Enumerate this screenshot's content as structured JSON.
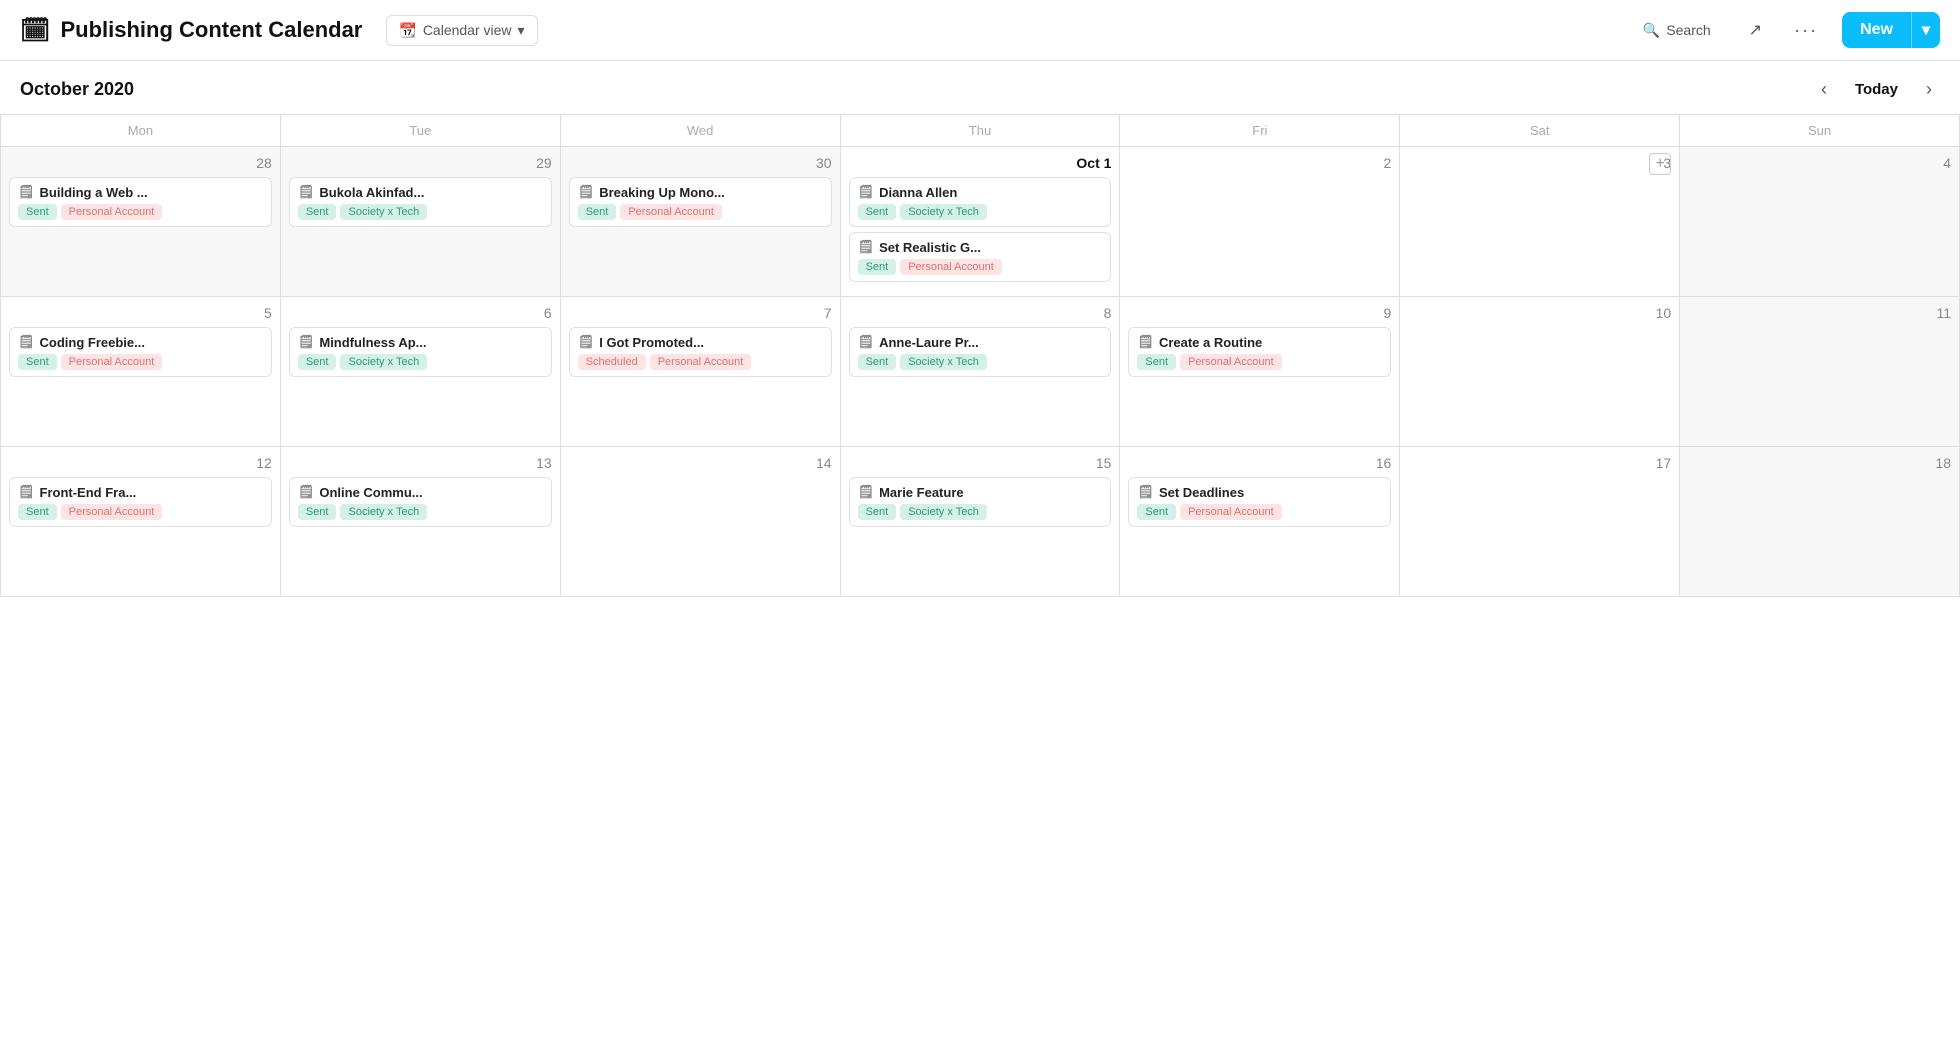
{
  "header": {
    "icon": "📅",
    "title": "Publishing Content Calendar",
    "view_icon": "31",
    "view_label": "Calendar view",
    "search_label": "Search",
    "new_label": "New"
  },
  "month_nav": {
    "title": "October 2020",
    "prev": "‹",
    "next": "›",
    "today": "Today"
  },
  "day_headers": [
    "Mon",
    "Tue",
    "Wed",
    "Thu",
    "Fri",
    "Sat",
    "Sun"
  ],
  "weeks": [
    [
      {
        "num": "28",
        "other": true,
        "cards": [
          {
            "title": "Building a Web ...",
            "tags": [
              {
                "label": "Sent",
                "type": "sent"
              },
              {
                "label": "Personal Account",
                "type": "personal"
              }
            ]
          }
        ]
      },
      {
        "num": "29",
        "other": true,
        "cards": [
          {
            "title": "Bukola Akinfad...",
            "tags": [
              {
                "label": "Sent",
                "type": "sent"
              },
              {
                "label": "Society x Tech",
                "type": "society"
              }
            ]
          }
        ]
      },
      {
        "num": "30",
        "other": true,
        "cards": [
          {
            "title": "Breaking Up Mono...",
            "tags": [
              {
                "label": "Sent",
                "type": "sent"
              },
              {
                "label": "Personal Account",
                "type": "personal"
              }
            ]
          }
        ]
      },
      {
        "num": "Oct 1",
        "today": true,
        "cards": [
          {
            "title": "Dianna Allen",
            "tags": [
              {
                "label": "Sent",
                "type": "sent"
              },
              {
                "label": "Society x Tech",
                "type": "society"
              }
            ]
          },
          {
            "title": "Set Realistic G...",
            "tags": [
              {
                "label": "Sent",
                "type": "sent"
              },
              {
                "label": "Personal Account",
                "type": "personal"
              }
            ]
          }
        ]
      },
      {
        "num": "2",
        "cards": []
      },
      {
        "num": "3",
        "cards": [],
        "add": true
      },
      {
        "num": "4",
        "other": true,
        "cards": []
      }
    ],
    [
      {
        "num": "5",
        "cards": [
          {
            "title": "Coding Freebie...",
            "tags": [
              {
                "label": "Sent",
                "type": "sent"
              },
              {
                "label": "Personal Account",
                "type": "personal"
              }
            ]
          }
        ]
      },
      {
        "num": "6",
        "cards": [
          {
            "title": "Mindfulness Ap...",
            "tags": [
              {
                "label": "Sent",
                "type": "sent"
              },
              {
                "label": "Society x Tech",
                "type": "society"
              }
            ]
          }
        ]
      },
      {
        "num": "7",
        "cards": [
          {
            "title": "I Got Promoted...",
            "tags": [
              {
                "label": "Scheduled",
                "type": "scheduled"
              },
              {
                "label": "Personal Account",
                "type": "personal"
              }
            ]
          }
        ]
      },
      {
        "num": "8",
        "cards": [
          {
            "title": "Anne-Laure Pr...",
            "tags": [
              {
                "label": "Sent",
                "type": "sent"
              },
              {
                "label": "Society x Tech",
                "type": "society"
              }
            ]
          }
        ]
      },
      {
        "num": "9",
        "cards": [
          {
            "title": "Create a Routine",
            "tags": [
              {
                "label": "Sent",
                "type": "sent"
              },
              {
                "label": "Personal Account",
                "type": "personal"
              }
            ]
          }
        ]
      },
      {
        "num": "10",
        "cards": []
      },
      {
        "num": "11",
        "other": true,
        "cards": []
      }
    ],
    [
      {
        "num": "12",
        "cards": [
          {
            "title": "Front-End Fra...",
            "tags": [
              {
                "label": "Sent",
                "type": "sent"
              },
              {
                "label": "Personal Account",
                "type": "personal"
              }
            ]
          }
        ]
      },
      {
        "num": "13",
        "cards": [
          {
            "title": "Online Commu...",
            "tags": [
              {
                "label": "Sent",
                "type": "sent"
              },
              {
                "label": "Society x Tech",
                "type": "society"
              }
            ]
          }
        ]
      },
      {
        "num": "14",
        "cards": []
      },
      {
        "num": "15",
        "cards": [
          {
            "title": "Marie Feature",
            "tags": [
              {
                "label": "Sent",
                "type": "sent"
              },
              {
                "label": "Society x Tech",
                "type": "society"
              }
            ]
          }
        ]
      },
      {
        "num": "16",
        "cards": [
          {
            "title": "Set Deadlines",
            "tags": [
              {
                "label": "Sent",
                "type": "sent"
              },
              {
                "label": "Personal Account",
                "type": "personal"
              }
            ]
          }
        ]
      },
      {
        "num": "17",
        "cards": []
      },
      {
        "num": "18",
        "other": true,
        "cards": []
      }
    ]
  ]
}
